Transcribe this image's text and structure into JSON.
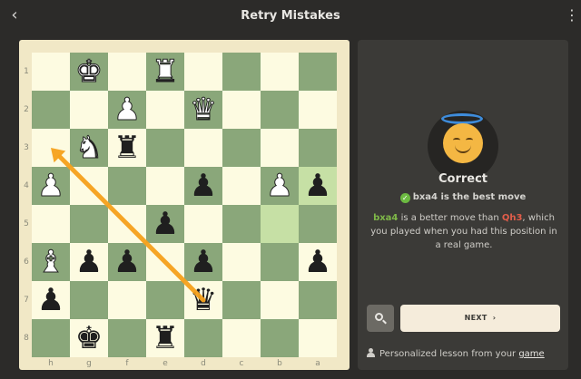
{
  "header": {
    "title": "Retry Mistakes",
    "back_icon": "chevron-left-icon",
    "menu_icon": "kebab-menu-icon"
  },
  "board": {
    "orientation": "black",
    "files": [
      "h",
      "g",
      "f",
      "e",
      "d",
      "c",
      "b",
      "a"
    ],
    "ranks": [
      "1",
      "2",
      "3",
      "4",
      "5",
      "6",
      "7",
      "8"
    ],
    "highlighted_squares": [
      "a4",
      "b5"
    ],
    "arrow": {
      "from": "d7",
      "to": "h3",
      "color": "#f6a11b"
    },
    "pieces": [
      {
        "sq": "g1",
        "glyph": "♚",
        "color": "white"
      },
      {
        "sq": "e1",
        "glyph": "♜",
        "color": "white"
      },
      {
        "sq": "f2",
        "glyph": "♟",
        "color": "white"
      },
      {
        "sq": "d2",
        "glyph": "♛",
        "color": "white"
      },
      {
        "sq": "g3",
        "glyph": "♞",
        "color": "white"
      },
      {
        "sq": "f3",
        "glyph": "♜",
        "color": "black"
      },
      {
        "sq": "h4",
        "glyph": "♟",
        "color": "white"
      },
      {
        "sq": "d4",
        "glyph": "♟",
        "color": "black"
      },
      {
        "sq": "b4",
        "glyph": "♟",
        "color": "white"
      },
      {
        "sq": "a4",
        "glyph": "♟",
        "color": "black"
      },
      {
        "sq": "e5",
        "glyph": "♟",
        "color": "black"
      },
      {
        "sq": "h6",
        "glyph": "♝",
        "color": "white"
      },
      {
        "sq": "g6",
        "glyph": "♟",
        "color": "black"
      },
      {
        "sq": "f6",
        "glyph": "♟",
        "color": "black"
      },
      {
        "sq": "d6",
        "glyph": "♟",
        "color": "black"
      },
      {
        "sq": "a6",
        "glyph": "♟",
        "color": "black"
      },
      {
        "sq": "h7",
        "glyph": "♟",
        "color": "black"
      },
      {
        "sq": "d7",
        "glyph": "♛",
        "color": "black"
      },
      {
        "sq": "g8",
        "glyph": "♚",
        "color": "black"
      },
      {
        "sq": "e8",
        "glyph": "♜",
        "color": "black"
      }
    ]
  },
  "panel": {
    "avatar_icon": "halo-smiley-icon",
    "result_title": "Correct",
    "check_icon": "check-circle-icon",
    "best_move_text": "bxa4 is the best move",
    "explanation": {
      "good_move": "bxa4",
      "mid_text": " is a better move than ",
      "bad_move": "Qh3",
      "tail_text": ", which you played when you had this position in a real game."
    },
    "search_icon": "magnifier-icon",
    "next_label": "NEXT",
    "next_icon": "chevron-right-icon",
    "lesson_text": "Personalized lesson from your ",
    "lesson_link": "game",
    "lesson_icon": "person-icon"
  },
  "colors": {
    "accent_green": "#6cba41",
    "bad_red": "#e25d4a",
    "arrow_orange": "#f6a11b"
  }
}
